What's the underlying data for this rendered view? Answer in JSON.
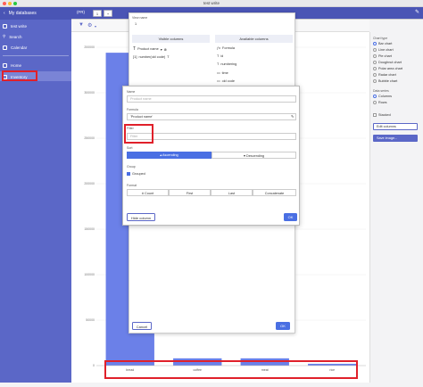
{
  "window": {
    "title": "test write"
  },
  "sidebar": {
    "back_label": "My databases",
    "items": [
      {
        "label": "test write"
      },
      {
        "label": "Search"
      },
      {
        "label": "Calendar"
      },
      {
        "label": "Home"
      },
      {
        "label": "Inventory"
      }
    ]
  },
  "topbar": {
    "label": "(FR)",
    "btn1": "1",
    "btn2": "+"
  },
  "chart_data": {
    "type": "bar",
    "categories": [
      "bread",
      "coffee",
      "meat",
      "rice"
    ],
    "values": [
      344000,
      8000,
      8000,
      2000
    ],
    "y_tick_labels": [
      "200000",
      "300000",
      "250000",
      "200000",
      "150000",
      "100000",
      "50000",
      "0"
    ]
  },
  "view_panel": {
    "name_label": "View name",
    "name_value": "1",
    "visible_header": "Visible columns",
    "available_header": "Available columns",
    "visible": [
      "Product name",
      "number(old code)"
    ],
    "available": [
      "Formula",
      "id",
      "numbering",
      "time",
      "old code"
    ]
  },
  "dialog": {
    "name_label": "Name",
    "name_placeholder": "Product name",
    "formula_label": "Formula",
    "formula_value": "'Product name'",
    "filter_label": "Filter",
    "filter_placeholder": "Filter",
    "sort_label": "Sort",
    "ascending": "Ascending",
    "descending": "Descending",
    "group_label": "Group",
    "grouped": "Grouped",
    "format_label": "Format",
    "formats": [
      "# Count",
      "First",
      "Last",
      "Concatenate"
    ],
    "hide_label": "Hide column",
    "ok_label": "OK"
  },
  "footer": {
    "cancel": "Cancel",
    "ok": "OK"
  },
  "right_panel": {
    "chart_type_label": "Chart type",
    "chart_types": [
      "Bar chart",
      "Line chart",
      "Pie chart",
      "Doughnut chart",
      "Polar area chart",
      "Radar chart",
      "Bubble chart"
    ],
    "data_series_label": "Data series",
    "series": [
      "Columns",
      "Rows"
    ],
    "stacked": "Stacked",
    "edit_columns": "Edit columns",
    "save_image": "Save image..."
  },
  "colors": {
    "accent": "#5b67c7",
    "bar": "#6b80e8",
    "highlight": "#e0202a"
  }
}
